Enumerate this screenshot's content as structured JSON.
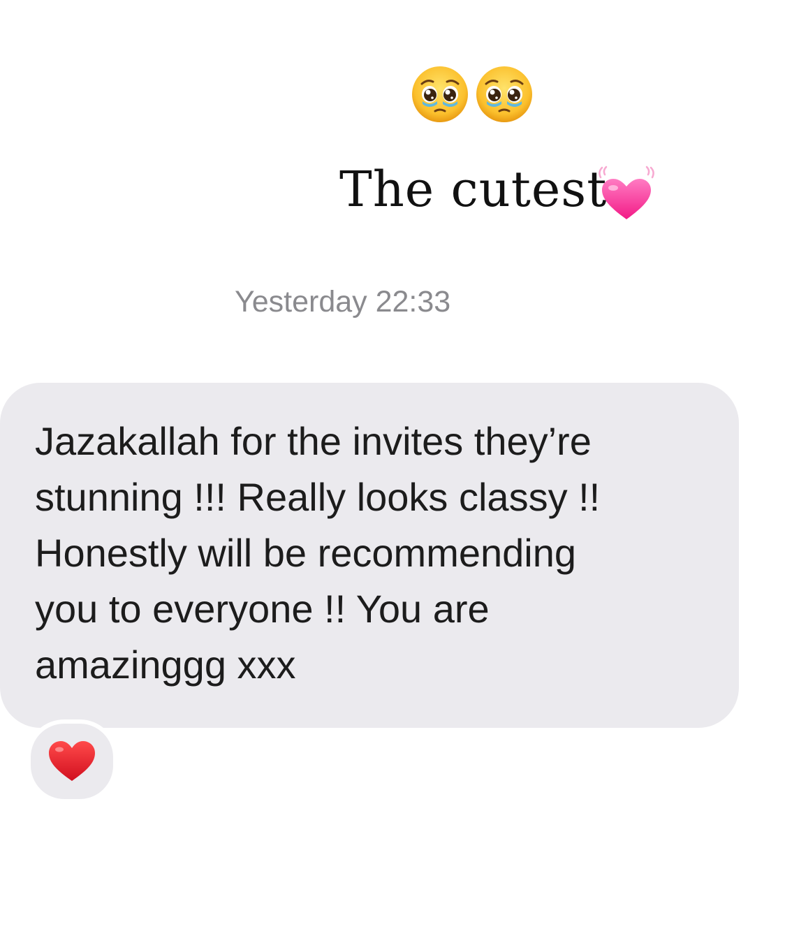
{
  "header": {
    "emojis": [
      "pleading-face-icon",
      "pleading-face-icon"
    ],
    "caption": "The cutest",
    "caption_icon": "growing-heart-icon"
  },
  "conversation": {
    "timestamp": "Yesterday 22:33",
    "message": {
      "lines": [
        "Jazakallah for the invites they’re",
        "stunning !!! Really looks classy !!",
        "Honestly will be recommending",
        "you to everyone !! You are",
        "amazinggg xxx"
      ],
      "reaction": "red-heart-icon"
    }
  },
  "colors": {
    "bubble": "#ebeaee",
    "timestamp": "#8a8a8e",
    "text": "#1c1c1c",
    "reaction_heart": "#e0162b",
    "caption_heart": "#ff3f9d"
  }
}
